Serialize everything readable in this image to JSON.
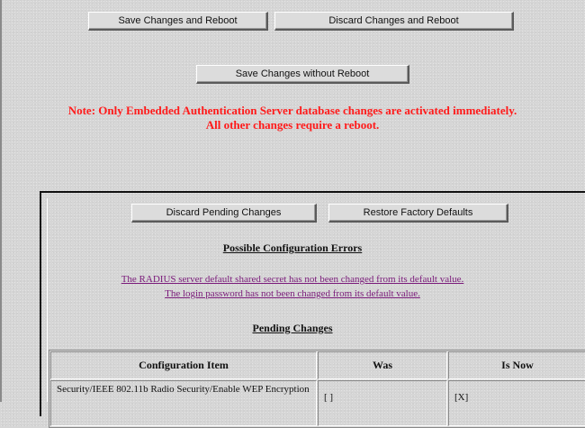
{
  "top_buttons": {
    "save_reboot": "Save Changes and Reboot",
    "discard_reboot": "Discard Changes and Reboot",
    "save_no_reboot": "Save Changes without Reboot"
  },
  "note": {
    "line1": "Note: Only Embedded Authentication Server database changes are activated immediately.",
    "line2": "All other changes require a reboot."
  },
  "pending_panel": {
    "discard_pending": "Discard Pending Changes",
    "restore_defaults": "Restore Factory Defaults",
    "errors_heading": "Possible Configuration Errors",
    "errors": [
      "The RADIUS server default shared secret has not been changed from its default value.",
      "The login password has not been changed from its default value."
    ],
    "changes_heading": "Pending Changes",
    "table": {
      "headers": [
        "Configuration Item",
        "Was",
        "Is Now"
      ],
      "rows": [
        {
          "item": "Security/IEEE 802.11b Radio Security/Enable WEP Encryption",
          "was": "[ ]",
          "is_now": "[X]"
        }
      ]
    }
  },
  "colors": {
    "note_text": "#ff1a1a",
    "link_text": "#7a1a7a",
    "background": "#d6d6d6"
  }
}
